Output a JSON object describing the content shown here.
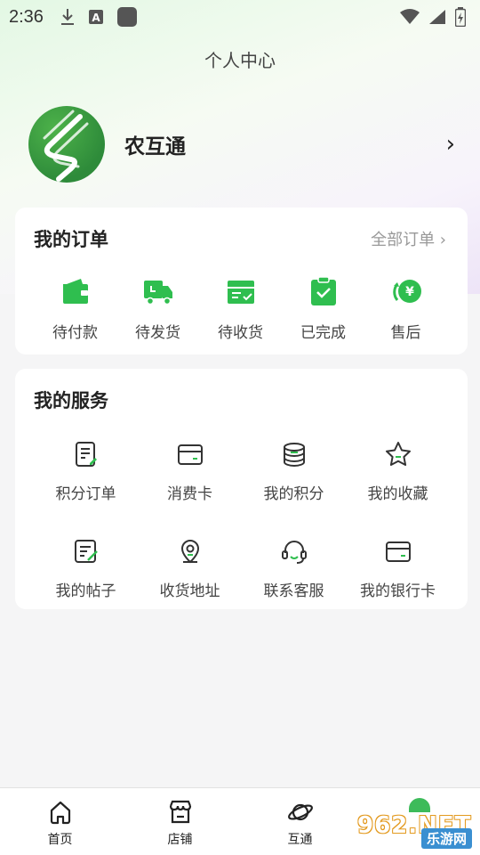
{
  "status_bar": {
    "time": "2:36",
    "icons_left": [
      "download-icon",
      "font-a-icon",
      "app-square-icon"
    ],
    "icons_right": [
      "wifi-icon",
      "signal-icon",
      "battery-icon"
    ]
  },
  "header": {
    "title": "个人中心"
  },
  "profile": {
    "name": "农互通",
    "avatar": "app-logo-avatar",
    "chevron": "›"
  },
  "orders": {
    "title": "我的订单",
    "more_label": "全部订单 ›",
    "items": [
      {
        "label": "待付款",
        "icon": "wallet-icon"
      },
      {
        "label": "待发货",
        "icon": "truck-icon"
      },
      {
        "label": "待收货",
        "icon": "package-check-icon"
      },
      {
        "label": "已完成",
        "icon": "clipboard-check-icon"
      },
      {
        "label": "售后",
        "icon": "yuan-refund-icon"
      }
    ]
  },
  "services": {
    "title": "我的服务",
    "items": [
      {
        "label": "积分订单",
        "icon": "document-edit-icon"
      },
      {
        "label": "消费卡",
        "icon": "card-icon"
      },
      {
        "label": "我的积分",
        "icon": "coins-stack-icon"
      },
      {
        "label": "我的收藏",
        "icon": "star-icon"
      },
      {
        "label": "我的帖子",
        "icon": "post-edit-icon"
      },
      {
        "label": "收货地址",
        "icon": "location-pin-icon"
      },
      {
        "label": "联系客服",
        "icon": "headset-icon"
      },
      {
        "label": "我的银行卡",
        "icon": "bank-card-icon"
      }
    ]
  },
  "tabbar": {
    "tabs": [
      {
        "label": "首页",
        "icon": "home-icon"
      },
      {
        "label": "店铺",
        "icon": "store-icon"
      },
      {
        "label": "互通",
        "icon": "planet-icon"
      }
    ]
  },
  "watermark": {
    "logo": "962.NET",
    "sub": "乐游网"
  },
  "colors": {
    "accent": "#2fbe4f",
    "text": "#222222",
    "muted": "#999999",
    "background": "#f5f5f6"
  }
}
